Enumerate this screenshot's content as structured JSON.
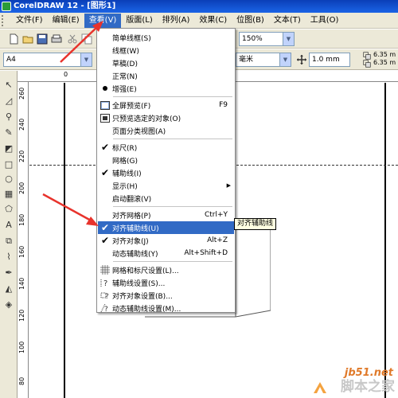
{
  "titlebar": {
    "title": "CorelDRAW 12 - [图形1]"
  },
  "menubar": {
    "items": [
      {
        "label": "文件(F)"
      },
      {
        "label": "编辑(E)"
      },
      {
        "label": "查看(V)"
      },
      {
        "label": "版面(L)"
      },
      {
        "label": "排列(A)"
      },
      {
        "label": "效果(C)"
      },
      {
        "label": "位图(B)"
      },
      {
        "label": "文本(T)"
      },
      {
        "label": "工具(O)"
      }
    ],
    "active_index": 2
  },
  "toolbar1": {
    "zoom_value": "150%"
  },
  "toolbar2": {
    "page_size": "A4",
    "units": "毫米",
    "nudge_value": "1.0 mm",
    "dup_x": "6.35 m",
    "dup_y": "6.35 m"
  },
  "rulers": {
    "top_labels": [
      "0",
      "10",
      "20"
    ],
    "left_labels": [
      "260",
      "240",
      "220",
      "200",
      "180",
      "160",
      "140",
      "120",
      "100",
      "80",
      "60"
    ]
  },
  "view_menu": {
    "items": [
      {
        "label": "简单线框(S)",
        "icon": "none"
      },
      {
        "label": "线框(W)",
        "icon": "none"
      },
      {
        "label": "草稿(D)",
        "icon": "none"
      },
      {
        "label": "正常(N)",
        "icon": "none"
      },
      {
        "label": "增强(E)",
        "icon": "bullet"
      },
      {
        "label": "全屏预览(F)",
        "icon": "fullscreen-icon",
        "shortcut": "F9"
      },
      {
        "label": "只预览选定的对象(O)",
        "icon": "preview-selected-icon"
      },
      {
        "label": "页面分类视图(A)",
        "icon": "none"
      },
      {
        "label": "标尺(R)",
        "icon": "check"
      },
      {
        "label": "网格(G)",
        "icon": "none"
      },
      {
        "label": "辅助线(I)",
        "icon": "check"
      },
      {
        "label": "显示(H)",
        "icon": "none",
        "submenu": true
      },
      {
        "label": "启动翻滚(V)",
        "icon": "none"
      },
      {
        "label": "对齐网格(P)",
        "icon": "none",
        "shortcut": "Ctrl+Y"
      },
      {
        "label": "对齐辅助线(U)",
        "icon": "check",
        "highlighted": true
      },
      {
        "label": "对齐对象(J)",
        "icon": "check",
        "shortcut": "Alt+Z"
      },
      {
        "label": "动态辅助线(Y)",
        "icon": "none",
        "shortcut": "Alt+Shift+D"
      },
      {
        "label": "网格和标尺设置(L)...",
        "icon": "grid-settings-icon"
      },
      {
        "label": "辅助线设置(S)...",
        "icon": "guideline-settings-icon"
      },
      {
        "label": "对齐对象设置(B)...",
        "icon": "snap-settings-icon"
      },
      {
        "label": "动态辅助线设置(M)...",
        "icon": "dynamic-guide-settings-icon"
      }
    ]
  },
  "tooltip": {
    "text": "对齐辅助线"
  },
  "watermark": {
    "site": "jb51.net",
    "brand": "脚本之家"
  },
  "colors": {
    "titlebar": "#0a3fb8",
    "menu_highlight": "#316ac5",
    "annotation_arrow": "#e8332c",
    "ui_face": "#ece9d8"
  }
}
